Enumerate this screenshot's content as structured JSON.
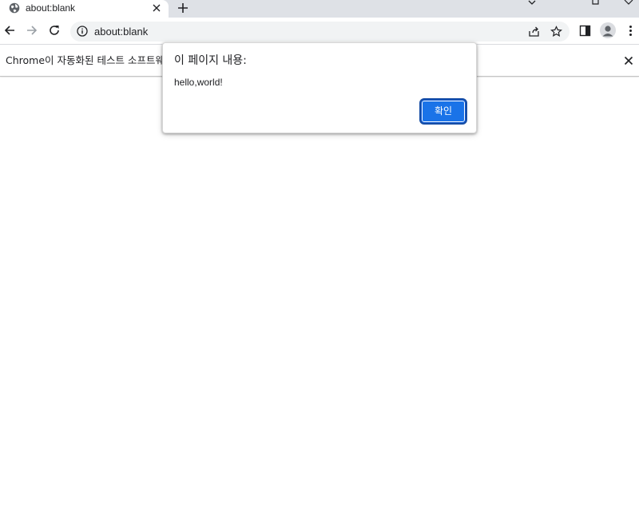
{
  "tab": {
    "title": "about:blank",
    "favicon": "globe-icon"
  },
  "toolbar": {
    "url": "about:blank",
    "back_icon": "back-arrow-icon",
    "forward_icon": "forward-arrow-icon",
    "reload_icon": "reload-icon"
  },
  "infobar": {
    "message": "Chrome이 자동화된 테스트 소프트웨어"
  },
  "dialog": {
    "title": "이 페이지 내용:",
    "message": "hello,world!",
    "ok_label": "확인"
  },
  "colors": {
    "tabstrip_bg": "#dee1e6",
    "omnibox_bg": "#f1f3f4",
    "accent": "#1a73e8"
  }
}
